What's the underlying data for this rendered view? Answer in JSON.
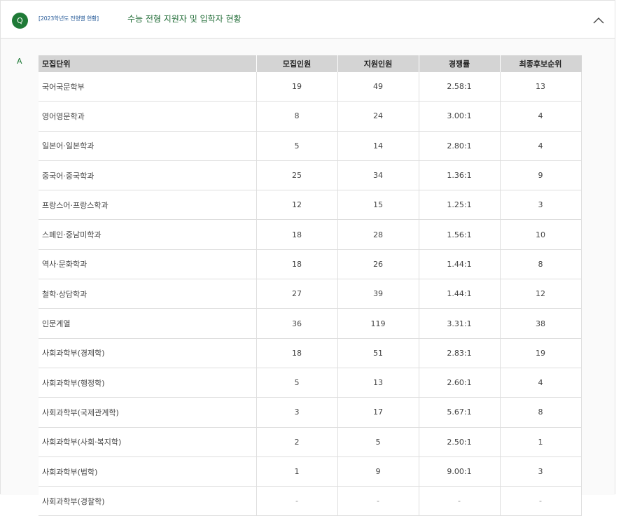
{
  "question": {
    "badge": "Q",
    "tag": "[2023학년도 전형별 현황]",
    "title": "수능 전형 지원자 및 입학자 현황"
  },
  "answer": {
    "badge": "A"
  },
  "table": {
    "headers": [
      "모집단위",
      "모집인원",
      "지원인원",
      "경쟁률",
      "최종후보순위"
    ],
    "rows": [
      [
        "국어국문학부",
        "19",
        "49",
        "2.58:1",
        "13"
      ],
      [
        "영어영문학과",
        "8",
        "24",
        "3.00:1",
        "4"
      ],
      [
        "일본어·일본학과",
        "5",
        "14",
        "2.80:1",
        "4"
      ],
      [
        "중국어·중국학과",
        "25",
        "34",
        "1.36:1",
        "9"
      ],
      [
        "프랑스어·프랑스학과",
        "12",
        "15",
        "1.25:1",
        "3"
      ],
      [
        "스페인·중남미학과",
        "18",
        "28",
        "1.56:1",
        "10"
      ],
      [
        "역사·문화학과",
        "18",
        "26",
        "1.44:1",
        "8"
      ],
      [
        "철학·상담학과",
        "27",
        "39",
        "1.44:1",
        "12"
      ],
      [
        "인문계열",
        "36",
        "119",
        "3.31:1",
        "38"
      ],
      [
        "사회과학부(경제학)",
        "18",
        "51",
        "2.83:1",
        "19"
      ],
      [
        "사회과학부(행정학)",
        "5",
        "13",
        "2.60:1",
        "4"
      ],
      [
        "사회과학부(국제관계학)",
        "3",
        "17",
        "5.67:1",
        "8"
      ],
      [
        "사회과학부(사회·복지학)",
        "2",
        "5",
        "2.50:1",
        "1"
      ],
      [
        "사회과학부(법학)",
        "1",
        "9",
        "9.00:1",
        "3"
      ],
      [
        "사회과학부(경찰학)",
        "-",
        "-",
        "-",
        "-"
      ]
    ]
  },
  "colors": {
    "accent": "#1f7a37",
    "header_bg": "#d4d4d4"
  }
}
